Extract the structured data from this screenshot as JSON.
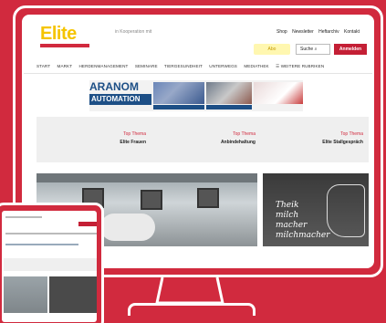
{
  "header": {
    "logo": "Elite",
    "partner": "in Kooperation mit",
    "toplinks": [
      "Shop",
      "Newsletter",
      "Heftarchiv",
      "Kontakt"
    ],
    "abo_label": "Abo",
    "search_label": "Suche",
    "login_label": "Anmelden"
  },
  "nav": {
    "items": [
      "START",
      "MARKT",
      "HERDENMANAGEMENT",
      "SEMINARE",
      "TIERGESUNDHEIT",
      "UNTERWEGS",
      "MEDIATHEK",
      "☰ WEITERE RUBRIKEN"
    ]
  },
  "banner": {
    "title_top": "ARANOM",
    "title_bottom": "AUTOMATION"
  },
  "topics": [
    {
      "label": "Top Thema",
      "title": "Elite Frauen"
    },
    {
      "label": "Top Thema",
      "title": "Anbindehaltung"
    },
    {
      "label": "Top Thema",
      "title": "Elite Stallgespräch"
    }
  ],
  "side_promo": {
    "line1": "Theik",
    "line2": "milch",
    "line3": "macher",
    "line4": "milchmacher"
  },
  "colors": {
    "background": "#d12a3e",
    "logo": "#f5c400",
    "accent": "#c41f35",
    "banner_blue": "#1d4f86"
  }
}
